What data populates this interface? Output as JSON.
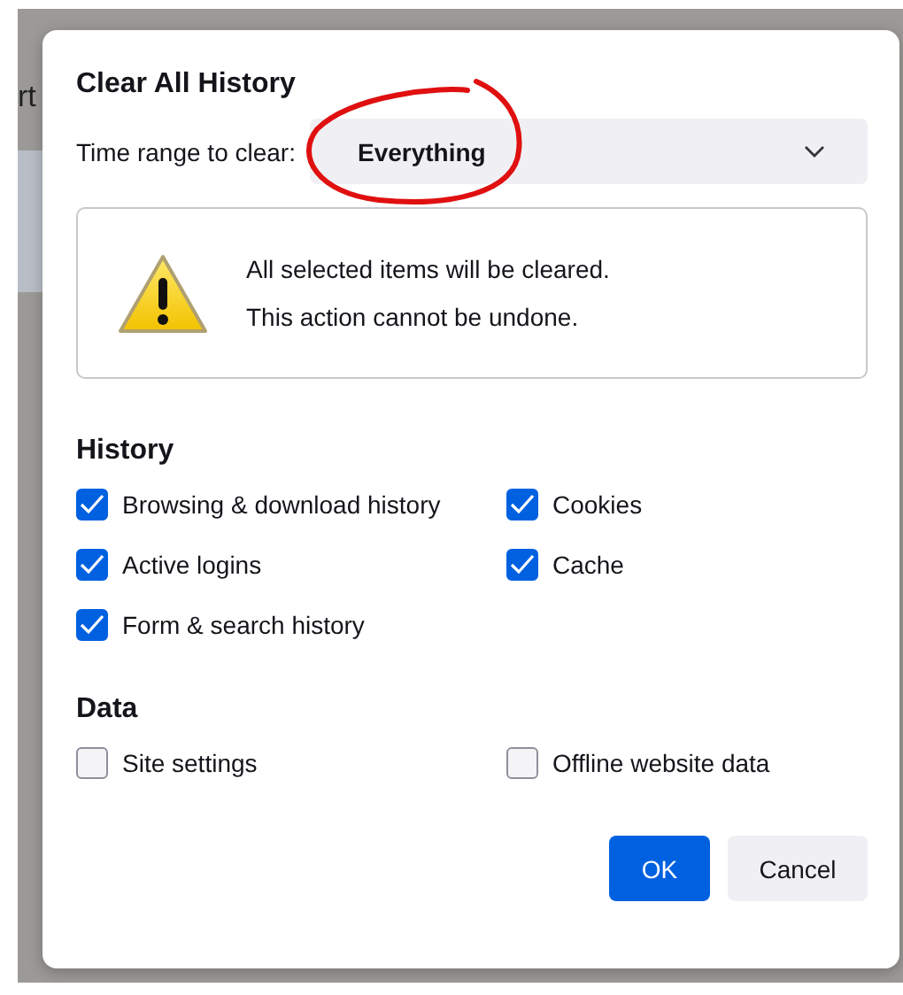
{
  "backdrop": {
    "text_fragment": "rt"
  },
  "dialog": {
    "title": "Clear All History",
    "time_range": {
      "label": "Time range to clear:",
      "value": "Everything"
    },
    "warning": {
      "lines": [
        "All selected items will be cleared.",
        "This action cannot be undone."
      ]
    },
    "sections": [
      {
        "heading": "History",
        "items": [
          {
            "label": "Browsing & download history",
            "checked": true
          },
          {
            "label": "Cookies",
            "checked": true
          },
          {
            "label": "Active logins",
            "checked": true
          },
          {
            "label": "Cache",
            "checked": true
          },
          {
            "label": "Form & search history",
            "checked": true
          }
        ]
      },
      {
        "heading": "Data",
        "items": [
          {
            "label": "Site settings",
            "checked": false
          },
          {
            "label": "Offline website data",
            "checked": false
          }
        ]
      }
    ],
    "buttons": [
      {
        "label": "OK",
        "kind": "primary"
      },
      {
        "label": "Cancel",
        "kind": "secondary"
      }
    ]
  }
}
